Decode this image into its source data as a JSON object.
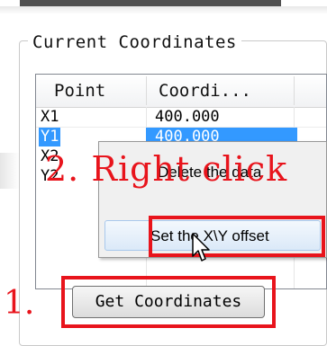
{
  "groupbox": {
    "title": "Current Coordinates"
  },
  "listview": {
    "columns": [
      "Point",
      "Coordi..."
    ],
    "rows": [
      {
        "point": "X1",
        "coord": "400.000",
        "selected": false
      },
      {
        "point": "Y1",
        "coord": "400.000",
        "selected": true
      },
      {
        "point": "X2",
        "coord": "",
        "selected": false
      },
      {
        "point": "Y2",
        "coord": "",
        "selected": false
      }
    ]
  },
  "context_menu": {
    "items": [
      {
        "label": "Delete the data"
      },
      {
        "label": "Set the X\\Y offset"
      }
    ]
  },
  "button": {
    "label": "Get Coordinates"
  },
  "annotations": {
    "step1": "1.",
    "step2": "2. Right click",
    "color": "#e8141c"
  },
  "colors": {
    "selection": "#3399ff",
    "annotation": "#e8141c"
  }
}
